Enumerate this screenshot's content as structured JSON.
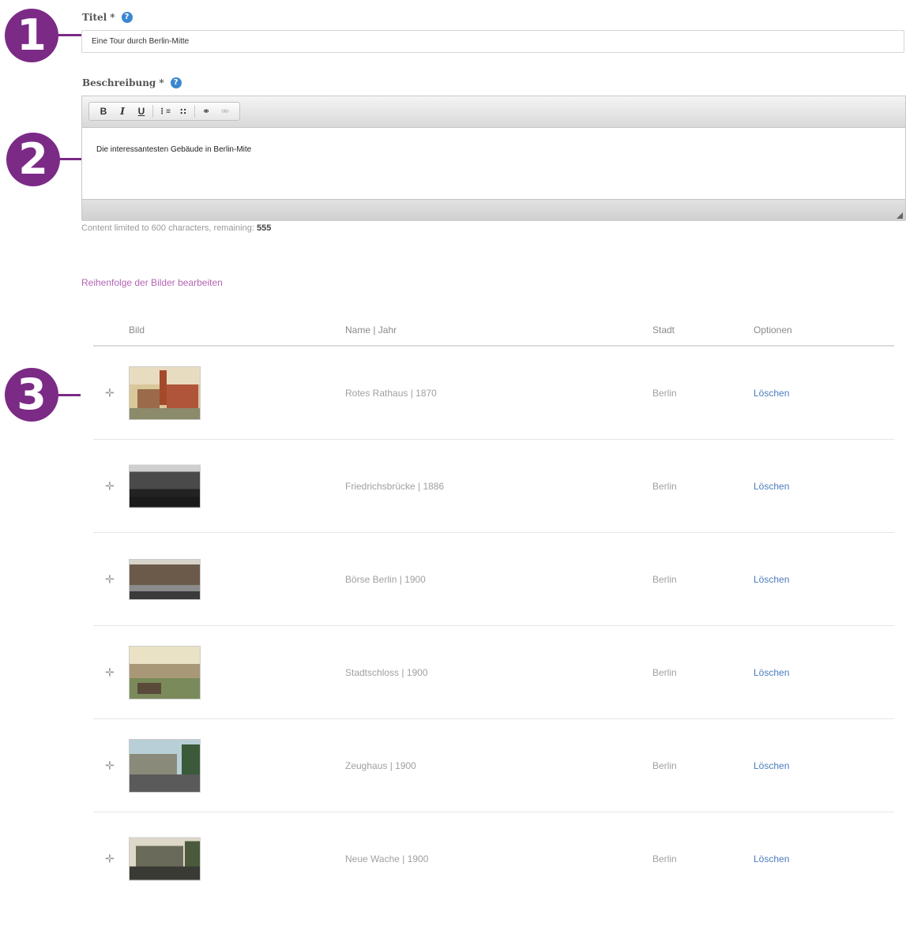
{
  "title_field": {
    "label": "Titel",
    "required_mark": "*",
    "help_icon": "?",
    "value": "Eine Tour durch Berlin-Mitte"
  },
  "description_field": {
    "label": "Beschreibung",
    "required_mark": "*",
    "help_icon": "?",
    "toolbar": {
      "bold": "B",
      "italic": "I",
      "underline": "U",
      "ordered_list": "⋮≡",
      "unordered_list": "∷",
      "link": "⚭",
      "unlink": "⚮"
    },
    "content": "Die interessantesten Gebäude in Berlin-Mite",
    "char_info_prefix": "Content limited to 600 characters, remaining:",
    "remaining": "555"
  },
  "callouts": [
    "1",
    "2",
    "3"
  ],
  "reorder_link": "Reihenfolge der Bilder bearbeiten",
  "table": {
    "headers": {
      "image": "Bild",
      "name_year": "Name | Jahr",
      "city": "Stadt",
      "options": "Optionen"
    },
    "rows": [
      {
        "name": "Rotes Rathaus | 1870",
        "city": "Berlin",
        "action": "Löschen"
      },
      {
        "name": "Friedrichsbrücke | 1886",
        "city": "Berlin",
        "action": "Löschen"
      },
      {
        "name": "Börse Berlin | 1900",
        "city": "Berlin",
        "action": "Löschen"
      },
      {
        "name": "Stadtschloss | 1900",
        "city": "Berlin",
        "action": "Löschen"
      },
      {
        "name": "Zeughaus | 1900",
        "city": "Berlin",
        "action": "Löschen"
      },
      {
        "name": "Neue Wache | 1900",
        "city": "Berlin",
        "action": "Löschen"
      }
    ]
  },
  "icons": {
    "drag_handle": "drag-handle-icon",
    "help": "help-icon",
    "callout": "numbered-callout-icon"
  },
  "colors": {
    "callout": "#7b2a86",
    "link_purple": "#b565b5",
    "delete_blue": "#4a7cbf",
    "help_blue": "#3b87cf"
  }
}
